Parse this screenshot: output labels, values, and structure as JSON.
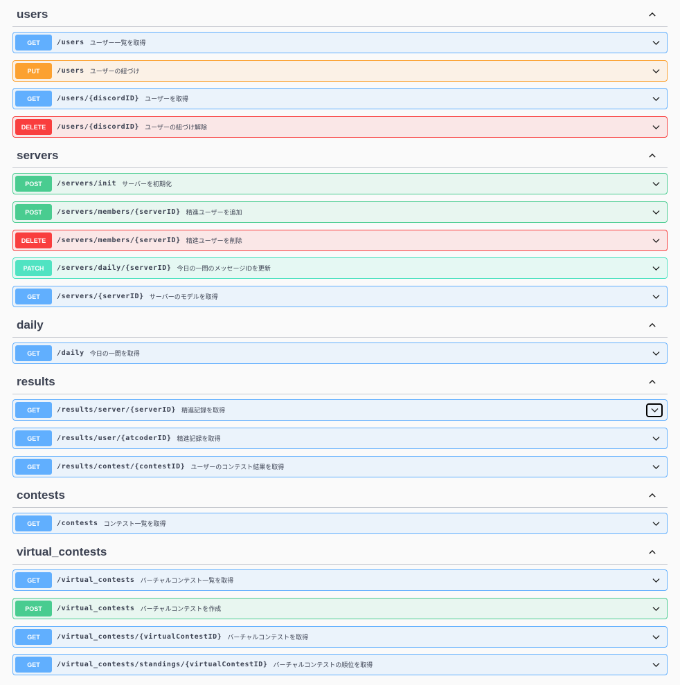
{
  "sections": [
    {
      "id": "users",
      "title": "users",
      "operations": [
        {
          "method": "GET",
          "path": "/users",
          "description": "ユーザー一覧を取得"
        },
        {
          "method": "PUT",
          "path": "/users",
          "description": "ユーザーの紐づけ"
        },
        {
          "method": "GET",
          "path": "/users/{discordID}",
          "description": "ユーザーを取得"
        },
        {
          "method": "DELETE",
          "path": "/users/{discordID}",
          "description": "ユーザーの紐づけ解除"
        }
      ]
    },
    {
      "id": "servers",
      "title": "servers",
      "operations": [
        {
          "method": "POST",
          "path": "/servers/init",
          "description": "サーバーを初期化"
        },
        {
          "method": "POST",
          "path": "/servers/members/{serverID}",
          "description": "精進ユーザーを追加"
        },
        {
          "method": "DELETE",
          "path": "/servers/members/{serverID}",
          "description": "精進ユーザーを削除"
        },
        {
          "method": "PATCH",
          "path": "/servers/daily/{serverID}",
          "description": "今日の一問のメッセージIDを更新"
        },
        {
          "method": "GET",
          "path": "/servers/{serverID}",
          "description": "サーバーのモデルを取得"
        }
      ]
    },
    {
      "id": "daily",
      "title": "daily",
      "operations": [
        {
          "method": "GET",
          "path": "/daily",
          "description": "今日の一問を取得"
        }
      ]
    },
    {
      "id": "results",
      "title": "results",
      "operations": [
        {
          "method": "GET",
          "path": "/results/server/{serverID}",
          "description": "精進記録を取得",
          "focused": true
        },
        {
          "method": "GET",
          "path": "/results/user/{atcoderID}",
          "description": "精進記録を取得"
        },
        {
          "method": "GET",
          "path": "/results/contest/{contestID}",
          "description": "ユーザーのコンテスト結果を取得"
        }
      ]
    },
    {
      "id": "contests",
      "title": "contests",
      "operations": [
        {
          "method": "GET",
          "path": "/contests",
          "description": "コンテスト一覧を取得"
        }
      ]
    },
    {
      "id": "virtual_contests",
      "title": "virtual_contests",
      "operations": [
        {
          "method": "GET",
          "path": "/virtual_contests",
          "description": "バーチャルコンテスト一覧を取得"
        },
        {
          "method": "POST",
          "path": "/virtual_contests",
          "description": "バーチャルコンテストを作成"
        },
        {
          "method": "GET",
          "path": "/virtual_contests/{virtualContestID}",
          "description": "バーチャルコンテストを取得"
        },
        {
          "method": "GET",
          "path": "/virtual_contests/standings/{virtualContestID}",
          "description": "バーチャルコンテストの順位を取得"
        }
      ]
    }
  ]
}
